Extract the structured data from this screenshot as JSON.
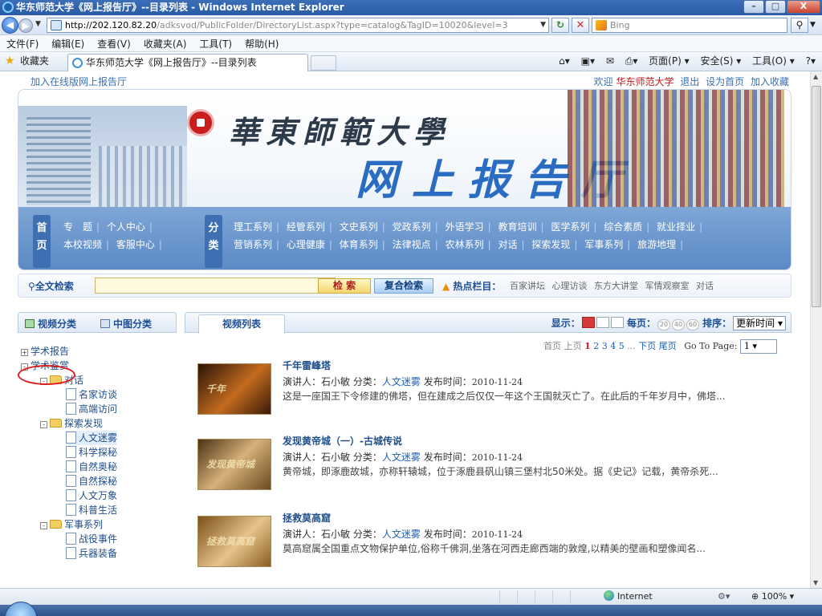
{
  "window": {
    "title": "华东师范大学《网上报告厅》--目录列表 - Windows Internet Explorer",
    "controls": {
      "minimize": "–",
      "maximize": "□",
      "close": "X"
    }
  },
  "address_bar": {
    "url_host": "http://202.120.82.20",
    "url_path": "/adksvod/PublicFolder/DirectoryList.aspx?type=catalog&TagID=10020&level=3",
    "search_placeholder": "Bing"
  },
  "menu": [
    "文件(F)",
    "编辑(E)",
    "查看(V)",
    "收藏夹(A)",
    "工具(T)",
    "帮助(H)"
  ],
  "favorites_bar": {
    "label": "收藏夹",
    "tab_title": "华东师范大学《网上报告厅》--目录列表",
    "commands": [
      "页面(P) ▾",
      "安全(S) ▾",
      "工具(O) ▾"
    ]
  },
  "page": {
    "top_left_link": "加入在线版网上报告厅",
    "welcome": {
      "prefix": "欢迎",
      "user": "华东师范大学",
      "links": [
        "退出",
        "设为首页",
        "加入收藏"
      ]
    },
    "banner": {
      "line1": "華東師範大學",
      "line2": "网上报告厅"
    },
    "nav": {
      "tag1": [
        "首",
        "页"
      ],
      "tag2": [
        "分",
        "类"
      ],
      "row1": [
        "专　题",
        "个人中心"
      ],
      "row2": [
        "本校视频",
        "客服中心"
      ],
      "row3": [
        "理工系列",
        "经管系列",
        "文史系列",
        "党政系列",
        "外语学习",
        "教育培训",
        "医学系列",
        "综合素质",
        "就业择业"
      ],
      "row4": [
        "营销系列",
        "心理健康",
        "体育系列",
        "法律视点",
        "农林系列",
        "对话",
        "探索发现",
        "军事系列",
        "旅游地理"
      ]
    },
    "search": {
      "label": "全文检索",
      "search_button": "检 索",
      "advanced_button": "复合检索",
      "hot_label": "热点栏目：",
      "hot_items": [
        "百家讲坛",
        "心理访谈",
        "东方大讲堂",
        "军情观察室",
        "对话"
      ]
    },
    "left_panel": {
      "tabs": [
        "视频分类",
        "中图分类"
      ],
      "tree": [
        {
          "label": "学术报告",
          "type": "root",
          "toggle": "+"
        },
        {
          "label": "学术鉴赏",
          "type": "root",
          "toggle": "-"
        },
        {
          "label": "对话",
          "type": "folder",
          "toggle": "-"
        },
        {
          "label": "名家访谈",
          "type": "doc"
        },
        {
          "label": "高端访问",
          "type": "doc"
        },
        {
          "label": "探索发现",
          "type": "folder",
          "toggle": "-"
        },
        {
          "label": "人文迷雾",
          "type": "doc",
          "selected": true
        },
        {
          "label": "科学探秘",
          "type": "doc"
        },
        {
          "label": "自然奥秘",
          "type": "doc"
        },
        {
          "label": "自然探秘",
          "type": "doc"
        },
        {
          "label": "人文万象",
          "type": "doc"
        },
        {
          "label": "科普生活",
          "type": "doc"
        },
        {
          "label": "军事系列",
          "type": "folder",
          "toggle": "-"
        },
        {
          "label": "战役事件",
          "type": "doc"
        },
        {
          "label": "兵器装备",
          "type": "doc"
        }
      ]
    },
    "right_panel": {
      "tab": "视频列表",
      "display_label": "显示：",
      "per_page_label": "每页：",
      "per_page_options": [
        "20",
        "40",
        "60"
      ],
      "sort_label": "排序：",
      "sort_value": "更新时间 ▾",
      "pager": {
        "first": "首页",
        "prev": "上页",
        "pages": [
          "1",
          "2",
          "3",
          "4",
          "5"
        ],
        "ellipsis": "...",
        "next": "下页",
        "last": "尾页",
        "goto_label": "Go To Page:",
        "goto_value": "1 ▾"
      },
      "videos": [
        {
          "title": "千年雷峰塔",
          "speaker_label": "演讲人：",
          "speaker": "石小敏",
          "category_label": "分类：",
          "category": "人文迷雾",
          "date_label": "发布时间：",
          "date": "2010-11-24",
          "desc": "这是一座国王下令修建的佛塔，但在建成之后仅仅一年这个王国就灭亡了。在此后的千年岁月中，佛塔...",
          "thumb_text": "千年"
        },
        {
          "title": "发现黄帝城（一）-古城传说",
          "speaker_label": "演讲人：",
          "speaker": "石小敏",
          "category_label": "分类：",
          "category": "人文迷雾",
          "date_label": "发布时间：",
          "date": "2010-11-24",
          "desc": "黄帝城，即涿鹿故城，亦称轩辕城，位于涿鹿县矾山镇三堡村北50米处。据《史记》记载，黄帝杀死...",
          "thumb_text": "发现黄帝城"
        },
        {
          "title": "拯救莫高窟",
          "speaker_label": "演讲人：",
          "speaker": "石小敏",
          "category_label": "分类：",
          "category": "人文迷雾",
          "date_label": "发布时间：",
          "date": "2010-11-24",
          "desc": "莫高窟属全国重点文物保护单位,俗称千佛洞,坐落在河西走廊西端的敦煌,以精美的壁画和塑像闻名...",
          "thumb_text": "拯救莫高窟"
        }
      ]
    }
  },
  "status_bar": {
    "zone": "Internet",
    "zoom": "100%"
  },
  "colors": {
    "accent": "#2a6cc2",
    "highlight_red": "#e01d1d"
  }
}
